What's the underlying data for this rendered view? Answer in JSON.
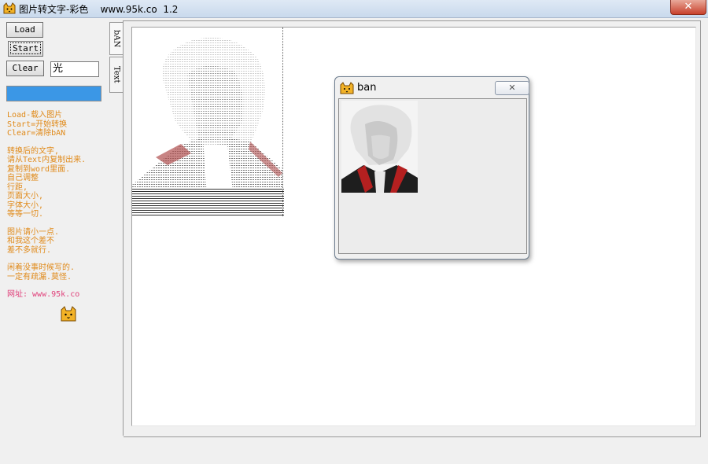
{
  "window": {
    "title": "图片转文字-彩色    www.95k.co  1.2",
    "close_symbol": "✕"
  },
  "buttons": {
    "load": "Load",
    "start": "Start",
    "clear": "Clear"
  },
  "char_input": {
    "value": "光"
  },
  "progress": {
    "value": 1.0,
    "color": "#3b97e6"
  },
  "help_text": {
    "group1": [
      "Load-载入图片",
      "Start=开始转换",
      "Clear=清除bAN"
    ],
    "group2": [
      "转换后的文字,",
      "请从Text内复制出来.",
      "复制到word里面.",
      "自己调整",
      "行距,",
      "页面大小,",
      "字体大小,",
      "等等一切."
    ],
    "group3": [
      "图片请小一点.",
      "和我这个差不",
      "差不多就行."
    ],
    "group4": [
      "闲着没事时候写的.",
      "一定有疏漏.莫怪."
    ],
    "url": "网址: www.95k.co",
    "text_color": "#e08a1a",
    "url_color": "#e0407a"
  },
  "tabs": [
    {
      "label": "bAN"
    },
    {
      "label": "Text"
    }
  ],
  "dialog": {
    "title": "ban",
    "close_symbol": "✕"
  },
  "icons": {
    "app": "cat-face-icon",
    "help_cat": "cat-face-icon",
    "dialog": "cat-face-icon"
  }
}
